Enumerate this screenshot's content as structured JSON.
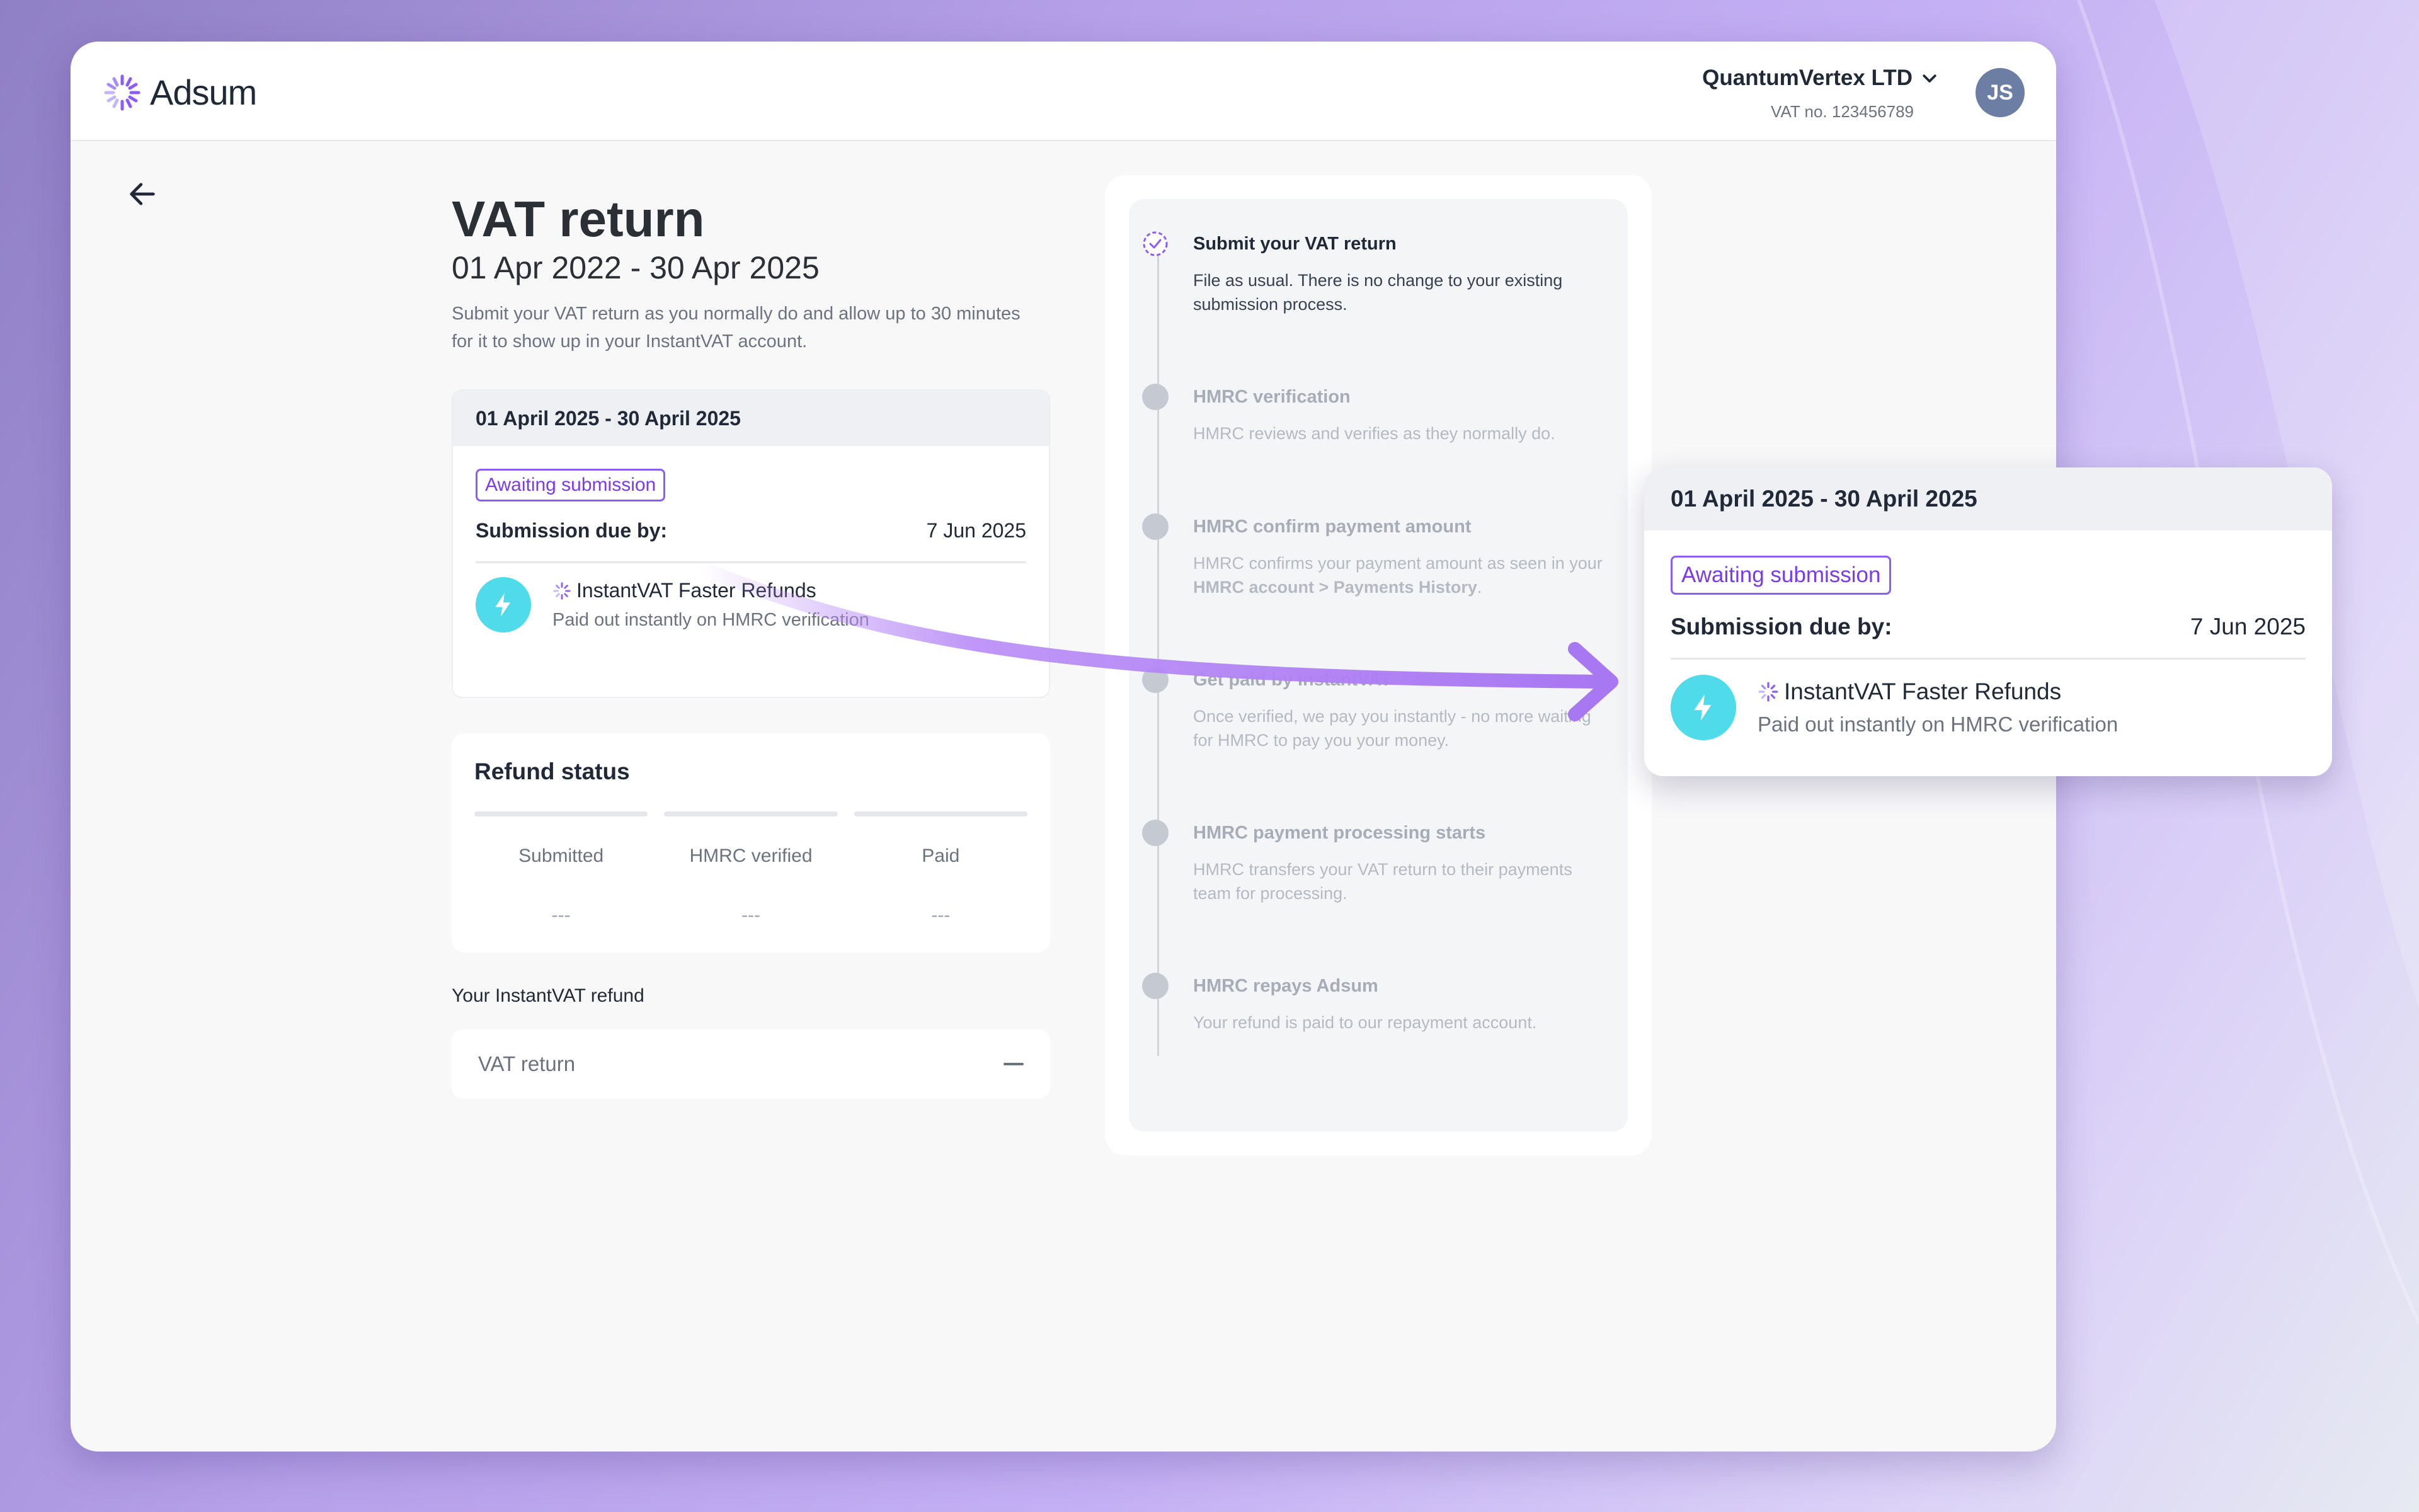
{
  "brand": {
    "name": "Adsum",
    "accent": "#8b5cf6"
  },
  "header": {
    "company": "QuantumVertex LTD",
    "vat_no": "VAT no. 123456789",
    "avatar_initials": "JS"
  },
  "page": {
    "title": "VAT return",
    "subtitle": "01 Apr 2022 - 30 Apr 2025",
    "description": "Submit your VAT return as you normally do and allow up to 30 minutes for it to show up in your InstantVAT account."
  },
  "period_card": {
    "period": "01 April 2025 - 30 April 2025",
    "status": "Awaiting submission",
    "due_label": "Submission due by:",
    "due_date": "7 Jun 2025",
    "feature_title": "InstantVAT Faster Refunds",
    "feature_sub": "Paid out instantly on HMRC verification"
  },
  "refund_status": {
    "title": "Refund status",
    "steps": [
      {
        "label": "Submitted",
        "value": "---"
      },
      {
        "label": "HMRC verified",
        "value": "---"
      },
      {
        "label": "Paid",
        "value": "---"
      }
    ]
  },
  "your_refund": {
    "label": "Your InstantVAT refund",
    "row_label": "VAT return"
  },
  "timeline": [
    {
      "title": "Submit your VAT return",
      "desc": "File as usual. There is no change to your existing submission process.",
      "active": true
    },
    {
      "title": "HMRC verification",
      "desc": "HMRC reviews and verifies as they normally do."
    },
    {
      "title": "HMRC confirm payment amount",
      "desc_pre": "HMRC confirms your payment amount as seen in your ",
      "desc_bold": "HMRC account > Payments History",
      "desc_post": "."
    },
    {
      "title": "Get paid by InstantVAT",
      "desc": "Once verified, we pay you instantly - no more waiting for HMRC to pay you your money."
    },
    {
      "title": "HMRC payment processing starts",
      "desc": "HMRC transfers your VAT return to their payments team for processing."
    },
    {
      "title": "HMRC repays Adsum",
      "desc": "Your refund is paid to our repayment account."
    }
  ]
}
